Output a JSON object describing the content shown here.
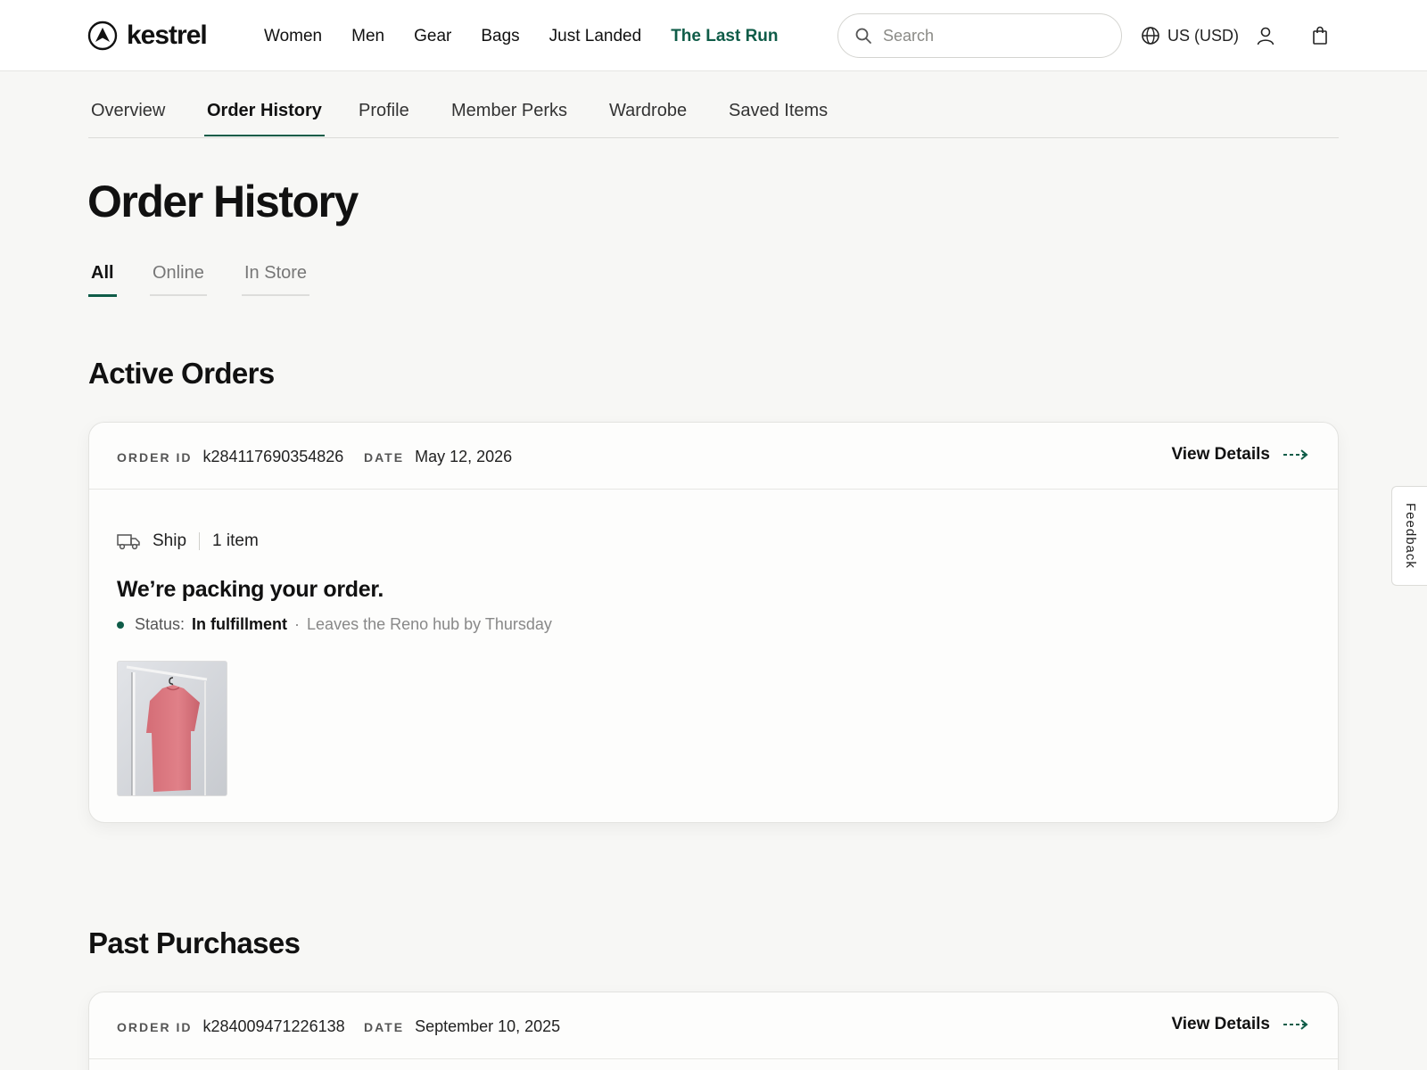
{
  "brand": {
    "name": "kestrel",
    "logo_icon": "kestrel-arrow-logo"
  },
  "main_nav": {
    "items": [
      {
        "label": "Women"
      },
      {
        "label": "Men"
      },
      {
        "label": "Gear"
      },
      {
        "label": "Bags"
      },
      {
        "label": "Just Landed"
      },
      {
        "label": "The Last Run",
        "highlight": true
      }
    ],
    "highlight_color": "#0f5c48"
  },
  "search": {
    "placeholder": "Search",
    "value": ""
  },
  "region": {
    "label": "US (USD)",
    "icon": "globe-icon"
  },
  "header_icons": [
    "account-icon",
    "shopping-bag-icon"
  ],
  "account_nav": {
    "items": [
      {
        "label": "Overview"
      },
      {
        "label": "Order History",
        "active": true
      },
      {
        "label": "Profile"
      },
      {
        "label": "Member Perks"
      },
      {
        "label": "Wardrobe"
      },
      {
        "label": "Saved Items"
      }
    ]
  },
  "page": {
    "title": "Order History"
  },
  "filters": {
    "tabs": [
      {
        "label": "All",
        "active": true
      },
      {
        "label": "Online"
      },
      {
        "label": "In Store"
      }
    ]
  },
  "active_orders": {
    "title": "Active Orders",
    "orders": [
      {
        "order_id_label": "ORDER ID",
        "order_id": "k284117690354826",
        "date_label": "DATE",
        "date": "May 12, 2026",
        "view_details": "View Details",
        "fulfillment": "Ship",
        "item_count": "1 item",
        "message": "We’re packing your order.",
        "status_label": "Status:",
        "status": "In fulfillment",
        "status_separator": "·",
        "status_note": "Leaves the Reno hub by Thursday",
        "status_color": "#0f5c48",
        "thumbnail": "pink-oversized-tee-on-rack"
      }
    ]
  },
  "past_purchases": {
    "title": "Past Purchases",
    "orders": [
      {
        "order_id_label": "ORDER ID",
        "order_id": "k284009471226138",
        "date_label": "DATE",
        "date": "September 10, 2025",
        "view_details": "View Details"
      }
    ]
  },
  "feedback": {
    "label": "Feedback"
  }
}
